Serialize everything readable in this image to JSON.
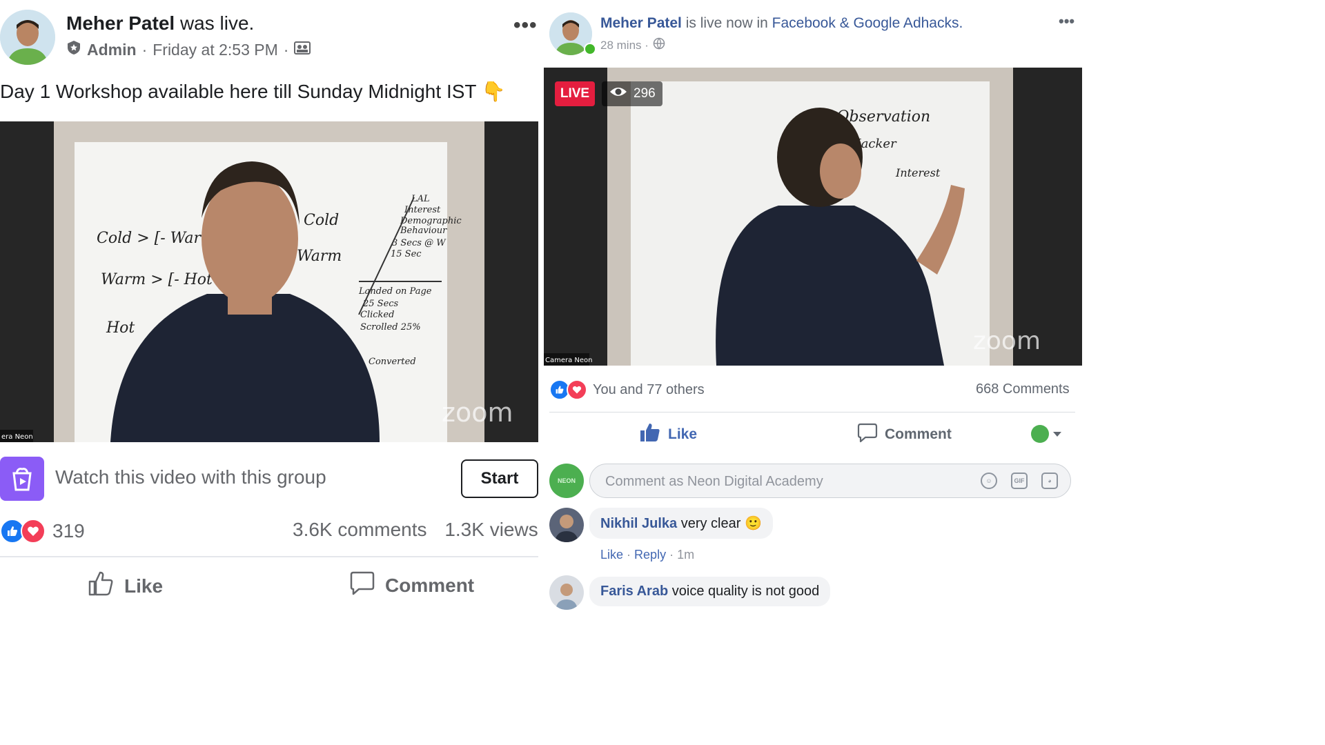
{
  "left_post": {
    "author": "Meher Patel",
    "status": "was live.",
    "role": "Admin",
    "time": "Friday at 2:53 PM",
    "text": "Day 1 Workshop available here till Sunday Midnight IST 👇",
    "video": {
      "whiteboard_text": [
        "Cold > [- Warm -",
        "Warm > [- Hot",
        "Hot",
        "Cold",
        "Warm",
        "LAL",
        "Interest",
        "Demographic",
        "Behaviour",
        "3 Secs @ W",
        "15 Sec",
        "Landed on Page",
        "25 Secs",
        "Clicked",
        "Scrolled 25%",
        "Converted"
      ],
      "watermark": "zoom",
      "camera_label": "era Neon"
    },
    "watch_party": {
      "text": "Watch this video with this group",
      "button": "Start"
    },
    "reaction_count": "319",
    "comments": "3.6K comments",
    "views": "1.3K views",
    "actions": {
      "like": "Like",
      "comment": "Comment"
    }
  },
  "right_post": {
    "author": "Meher Patel",
    "status": "is live now in",
    "group": "Facebook & Google Adhacks.",
    "time": "28 mins ·",
    "video": {
      "live_label": "LIVE",
      "viewer_count": "296",
      "whiteboard_text": [
        "/ Observation",
        "Hacker",
        "Interest"
      ],
      "watermark": "zoom",
      "camera_label": "Camera Neon"
    },
    "reactions_text": "You and 77 others",
    "comments_count": "668 Comments",
    "actions": {
      "like": "Like",
      "comment": "Comment"
    },
    "composer": {
      "placeholder": "Comment as Neon Digital Academy",
      "avatar_text": "NEON"
    },
    "comments": [
      {
        "author": "Nikhil Julka",
        "text": "very clear 🙂",
        "like": "Like",
        "reply": "Reply",
        "time": "1m"
      },
      {
        "author": "Faris Arab",
        "text": "voice quality is not good"
      }
    ]
  },
  "colors": {
    "facebook_blue": "#1877f2",
    "link_blue": "#385898",
    "love_red": "#f33e58",
    "live_red": "#e41e3f",
    "watch_party_purple": "#8b5cf6"
  }
}
